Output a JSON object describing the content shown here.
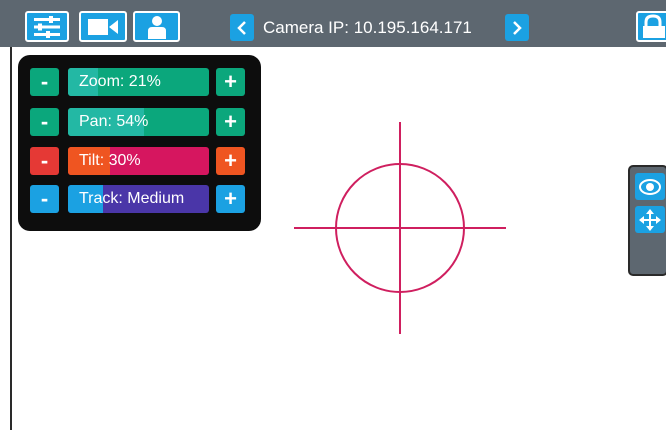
{
  "topbar": {
    "camera_label": "Camera IP: 10.195.164.171",
    "icons": [
      "sliders-icon",
      "video-camera-icon",
      "person-icon",
      "chevron-left-icon",
      "chevron-right-icon",
      "lock-icon"
    ]
  },
  "controls": [
    {
      "label": "Zoom: 21%",
      "minus": "-",
      "plus": "+",
      "level": 0.21,
      "color": "#0ba77c",
      "fill_color": "#23b8a4"
    },
    {
      "label": "Pan: 54%",
      "minus": "-",
      "plus": "+",
      "level": 0.54,
      "color": "#0ba77c",
      "fill_color": "#23b8a4"
    },
    {
      "label": "Tilt: 30%",
      "minus": "-",
      "plus": "+",
      "level": 0.3,
      "color": "#d6165f",
      "fill_color": "#ef5521"
    },
    {
      "label": "Track: Medium",
      "minus": "-",
      "plus": "+",
      "level": 0.25,
      "color": "#4a36a8",
      "fill_color": "#1ba1e2"
    }
  ],
  "colors": {
    "accent": "#1ba1e2",
    "topbar": "#5d6770",
    "crosshair": "#cf1f5f",
    "panel": "#0d0d0d"
  },
  "right_panel": {
    "icons": [
      "eye-icon",
      "move-arrows-icon"
    ]
  }
}
